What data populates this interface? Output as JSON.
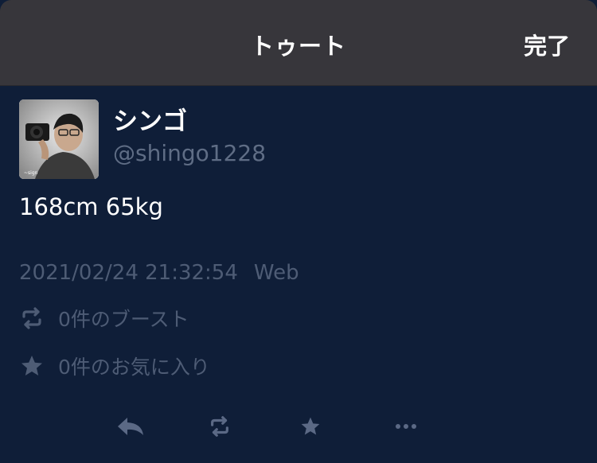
{
  "navbar": {
    "title": "トゥート",
    "done_label": "完了"
  },
  "account": {
    "display_name": "シンゴ",
    "handle": "@shingo1228"
  },
  "status": {
    "content": "168cm 65kg",
    "timestamp": "2021/02/24 21:32:54",
    "application": "Web",
    "boost_count_label": "0件のブースト",
    "favourite_count_label": "0件のお気に入り"
  },
  "icons": {
    "boost": "boost-icon",
    "favourite": "star-icon",
    "reply": "reply-icon",
    "more": "more-icon"
  },
  "colors": {
    "background": "#0f1e38",
    "navbar": "#37363b",
    "muted_text": "#4e5c75",
    "action_icon": "#5b6985"
  }
}
